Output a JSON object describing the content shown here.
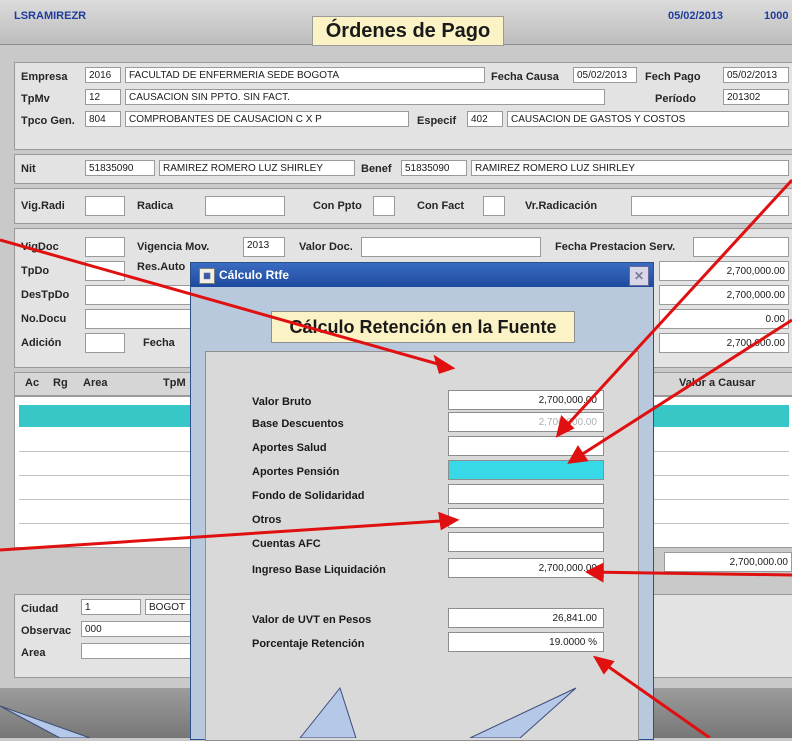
{
  "header": {
    "user": "LSRAMIREZR",
    "title": "Órdenes de Pago",
    "date": "05/02/2013",
    "number": "1000"
  },
  "form": {
    "empresa_label": "Empresa",
    "empresa_code": "2016",
    "empresa_name": "FACULTAD DE ENFERMERIA SEDE BOGOTA",
    "fecha_causa_label": "Fecha Causa",
    "fecha_causa": "05/02/2013",
    "fech_pago_label": "Fech Pago",
    "fech_pago": "05/02/2013",
    "tpmv_label": "TpMv",
    "tpmv_code": "12",
    "tpmv_name": "CAUSACION SIN PPTO. SIN FACT.",
    "periodo_label": "Período",
    "periodo": "201302",
    "tpco_label": "Tpco Gen.",
    "tpco_code": "804",
    "tpco_name": "COMPROBANTES DE CAUSACION C X P",
    "especif_label": "Especif",
    "especif_code": "402",
    "especif_name": "CAUSACION DE GASTOS Y COSTOS",
    "nit_label": "Nit",
    "nit": "51835090",
    "nit_name": "RAMIREZ ROMERO LUZ SHIRLEY",
    "benef_label": "Benef",
    "benef": "51835090",
    "benef_name": "RAMIREZ ROMERO LUZ SHIRLEY",
    "vigradi_label": "Vig.Radi",
    "radica_label": "Radica",
    "conppto_label": "Con Ppto",
    "confact_label": "Con Fact",
    "vrradicacion_label": "Vr.Radicación",
    "vigdoc_label": "VigDoc",
    "vigencia_label": "Vigencia Mov.",
    "vigencia": "2013",
    "valordoc_label": "Valor Doc.",
    "fechaprest_label": "Fecha Prestacion Serv.",
    "tpdo_label": "TpDo",
    "resauto_label": "Res.Auto",
    "destpdo_label": "DesTpDo",
    "nodocu_label": "No.Docu",
    "adicion_label": "Adición",
    "fecha_label": "Fecha",
    "right_values": [
      "2,700,000.00",
      "2,700,000.00",
      "0.00",
      "2,700,000.00"
    ]
  },
  "grid": {
    "columns": [
      "Ac",
      "Rg",
      "Area",
      "TpM",
      "Valor a Causar"
    ],
    "total": "2,700,000.00"
  },
  "bottom": {
    "ciudad_label": "Ciudad",
    "ciudad_code": "1",
    "ciudad_name": "BOGOT",
    "observac_label": "Observac",
    "observac": "000",
    "area_label": "Area"
  },
  "dialog": {
    "window_title": "Cálculo Rtfe",
    "heading": "Cálculo Retención en la Fuente",
    "fields": [
      {
        "label": "Valor Bruto",
        "value": "2,700,000.00"
      },
      {
        "label": "Base Descuentos",
        "value": "2,700,000.00"
      },
      {
        "label": "Aportes Salud",
        "value": ""
      },
      {
        "label": "Aportes Pensión",
        "value": ""
      },
      {
        "label": "Fondo de Solidaridad",
        "value": ""
      },
      {
        "label": "Otros",
        "value": ""
      },
      {
        "label": "Cuentas AFC",
        "value": ""
      },
      {
        "label": "Ingreso Base Liquidación",
        "value": "2,700,000.00"
      },
      {
        "label": "Valor de UVT en Pesos",
        "value": "26,841.00"
      },
      {
        "label": "Porcentaje Retención",
        "value": "19.0000 %"
      }
    ]
  },
  "colors": {
    "accent_cyan": "#37d9e8",
    "arrow_red": "#e01010",
    "dialog_title": "#2554ad"
  }
}
